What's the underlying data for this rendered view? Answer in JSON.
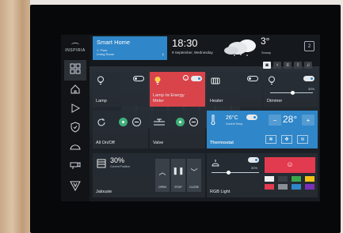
{
  "brand": {
    "logo_text": "INSPIRIA"
  },
  "header": {
    "title": "Smart Home",
    "floor": "1. Floor",
    "room": "Living Room",
    "chevron": "›",
    "time": "18:30",
    "date": "9 September, Wednesday",
    "temperature": "3°",
    "condition": "Snowy",
    "page_button": "2"
  },
  "quick_icons": [
    "camera-icon",
    "bulb-icon",
    "blinds-icon",
    "thermometer-icon",
    "music-icon"
  ],
  "tiles": {
    "lamp": {
      "label": "Lamp",
      "state": "off"
    },
    "lamp_meter": {
      "label_line1": "Lamp /w Energy",
      "label_line2": "Meter",
      "state": "on",
      "color": "#d9434a"
    },
    "heater": {
      "label": "Heater",
      "state": "off"
    },
    "dimmer": {
      "label": "Dimmer",
      "level_percent": "30%",
      "level": 0.3
    },
    "all_on_off": {
      "label": "All On/Off"
    },
    "valve": {
      "label": "Valve"
    },
    "thermostat": {
      "label": "Thermostat",
      "current_temp": "26°C",
      "current_caption": "Current Temp.",
      "setpoint": "28°",
      "minus": "−",
      "plus": "+",
      "color": "#2f86c8"
    },
    "jalousie": {
      "label": "Jalousie",
      "position": "30%",
      "position_caption": "Current Position",
      "open_label": "OPEN",
      "stop_label": "STOP",
      "close_label": "CLOSE"
    },
    "rgb_light": {
      "label": "RGB Light",
      "level_percent": "30%",
      "level": 0.3,
      "main_color": "#e23a4e",
      "swatches": [
        "#f0f0f0",
        "#3a3f46",
        "#3aa84a",
        "#f2c21a",
        "#e23a4e",
        "#8a8f96",
        "#2f86c8",
        "#7a2fb5"
      ]
    }
  }
}
